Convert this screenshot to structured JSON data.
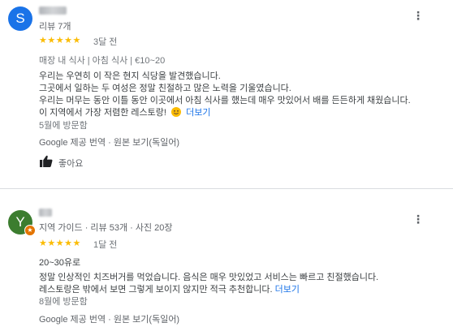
{
  "reviews": [
    {
      "avatar_letter": "S",
      "avatar_color": "#1a73e8",
      "meta": "리뷰 7개",
      "rating_stars": "★★★★★",
      "rating": 5,
      "time_ago": "3달 전",
      "tags": "매장 내 식사 | 아침 식사 | €10~20",
      "lines": [
        "우리는 우연히 이 작은 현지 식당을 발견했습니다.",
        "그곳에서 일하는 두 여성은 정말 친절하고 많은 노력을 기울였습니다.",
        "우리는 머무는 동안 이틀 동안 이곳에서 아침 식사를 했는데 매우 맛있어서 배를 든든하게 채웠습니다.",
        "이 지역에서 가장 저렴한 레스토랑!"
      ],
      "more_label": "더보기",
      "visited": "5월에 방문함",
      "translate_source": "Google 제공 번역",
      "translate_dot": "·",
      "translate_original": "원본 보기(독일어)",
      "like_label": "좋아요"
    },
    {
      "avatar_letter": "Y",
      "avatar_color": "#3c7d2f",
      "meta": "지역 가이드 · 리뷰 53개 · 사진 20장",
      "rating_stars": "★★★★★",
      "rating": 5,
      "time_ago": "1달 전",
      "price": "20~30유로",
      "lines": [
        "정말 인상적인 치즈버거를 먹었습니다. 음식은 매우 맛있었고 서비스는 빠르고 친절했습니다.",
        "레스토랑은 밖에서 보면 그렇게 보이지 않지만 적극 추천합니다."
      ],
      "more_label": "더보기",
      "visited": "8월에 방문함",
      "translate_source": "Google 제공 번역",
      "translate_dot": "·",
      "translate_original": "원본 보기(독일어)"
    }
  ],
  "icons": {
    "more": "more-vert-icon",
    "thumb": "thumb-up-icon",
    "emoji": "smiling-face-emoji",
    "guide_badge": "local-guide-star-icon"
  }
}
